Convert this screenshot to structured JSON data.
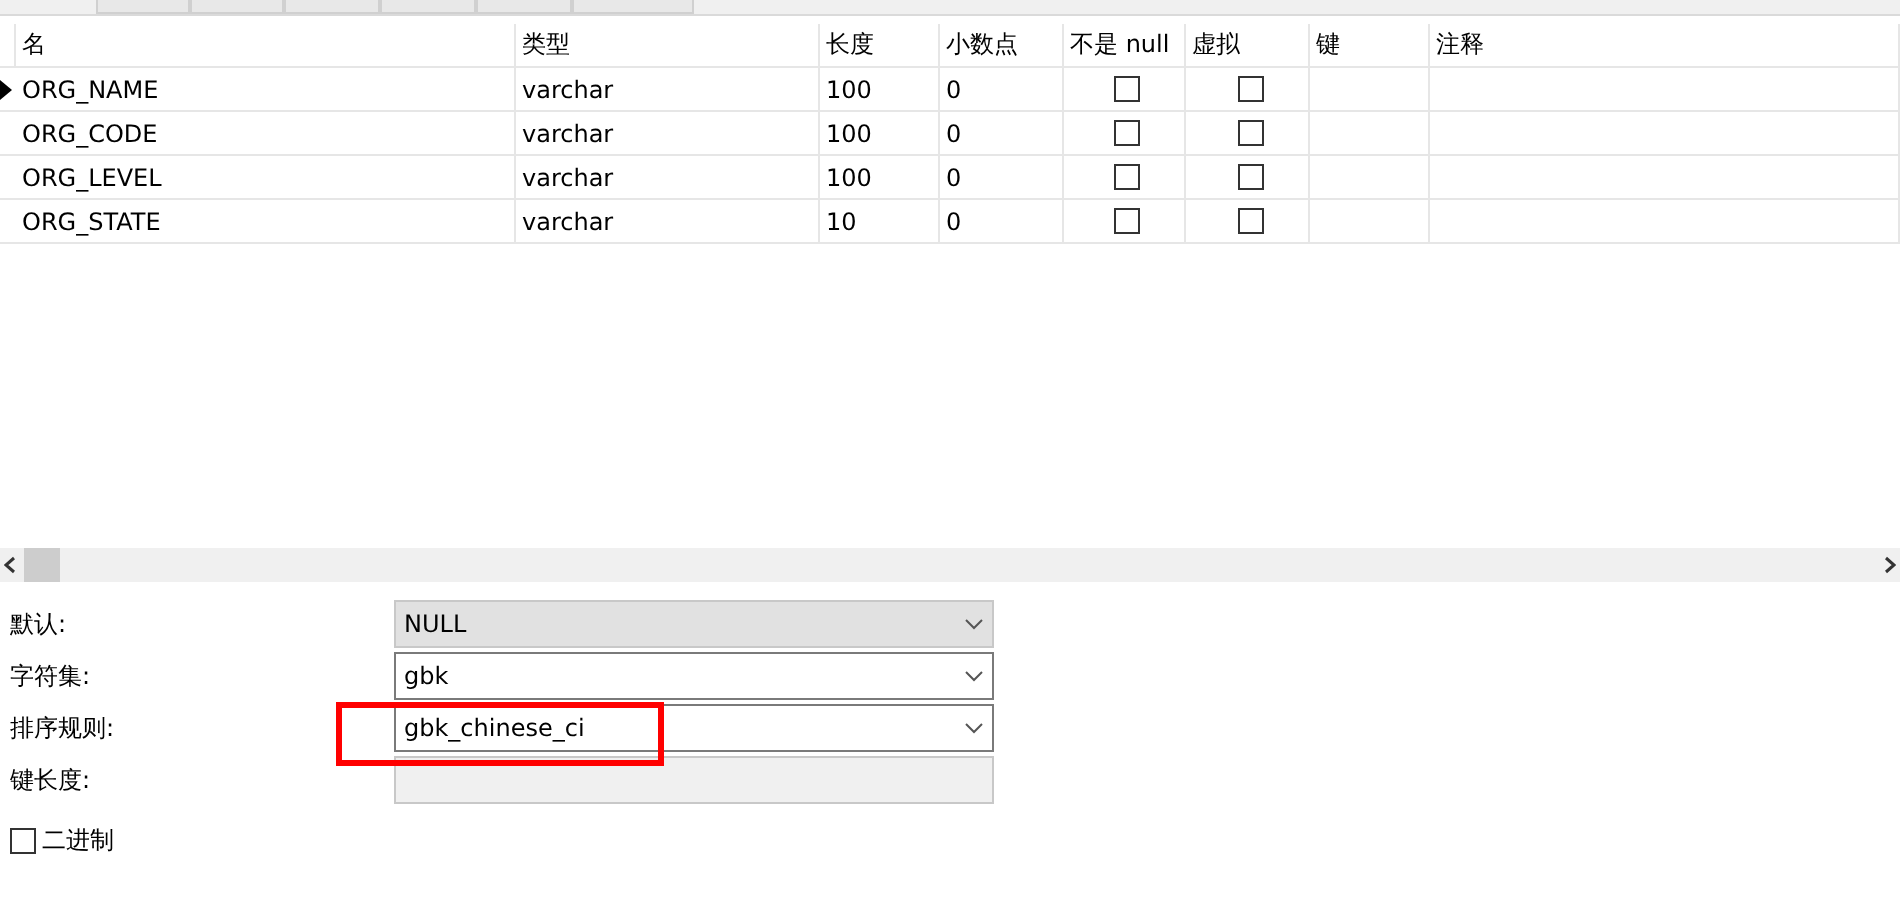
{
  "tabs": [
    {
      "selected": false
    },
    {
      "selected": false
    },
    {
      "selected": false
    },
    {
      "selected": false
    },
    {
      "selected": false
    },
    {
      "selected": false
    }
  ],
  "table": {
    "columns": [
      "名",
      "类型",
      "长度",
      "小数点",
      "不是 null",
      "虚拟",
      "键",
      "注释"
    ],
    "rows": [
      {
        "current": true,
        "name": "ORG_NAME",
        "type": "varchar",
        "length": "100",
        "decimals": "0",
        "not_null": false,
        "virtual": false
      },
      {
        "current": false,
        "name": "ORG_CODE",
        "type": "varchar",
        "length": "100",
        "decimals": "0",
        "not_null": false,
        "virtual": false
      },
      {
        "current": false,
        "name": "ORG_LEVEL",
        "type": "varchar",
        "length": "100",
        "decimals": "0",
        "not_null": false,
        "virtual": false
      },
      {
        "current": false,
        "name": "ORG_STATE",
        "type": "varchar",
        "length": "10",
        "decimals": "0",
        "not_null": false,
        "virtual": false
      }
    ]
  },
  "properties": [
    {
      "label": "默认:",
      "kind": "readonly-combo",
      "value": "NULL",
      "highlighted": false
    },
    {
      "label": "字符集:",
      "kind": "combo",
      "value": "gbk",
      "highlighted": false
    },
    {
      "label": "排序规则:",
      "kind": "combo",
      "value": "gbk_chinese_ci",
      "highlighted": true
    },
    {
      "label": "键长度:",
      "kind": "text",
      "disabled": true,
      "highlighted": false
    }
  ],
  "binary": {
    "label": "二进制",
    "checked": false
  }
}
